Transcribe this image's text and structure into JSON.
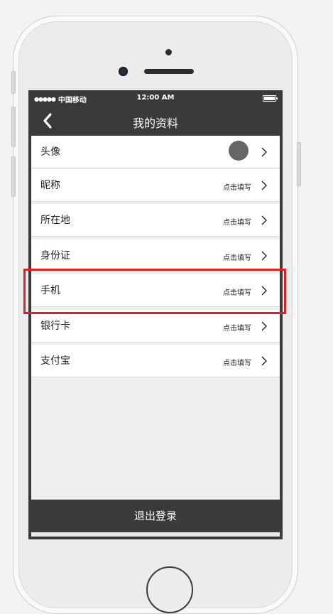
{
  "status_bar": {
    "carrier": "中国移动",
    "signal": "●●●●●",
    "time": "12:00 AM"
  },
  "nav": {
    "title": "我的资料"
  },
  "rows": [
    {
      "label": "头像",
      "hint": ""
    },
    {
      "label": "昵称",
      "hint": "点击填写"
    },
    {
      "label": "所在地",
      "hint": "点击填写"
    },
    {
      "label": "身份证",
      "hint": "点击填写"
    },
    {
      "label": "手机",
      "hint": "点击填写"
    },
    {
      "label": "银行卡",
      "hint": "点击填写"
    },
    {
      "label": "支付宝",
      "hint": "点击填写"
    }
  ],
  "logout": {
    "label": "退出登录"
  },
  "colors": {
    "dark": "#3a3a3a",
    "highlight": "#e02020",
    "avatar": "#666666"
  }
}
